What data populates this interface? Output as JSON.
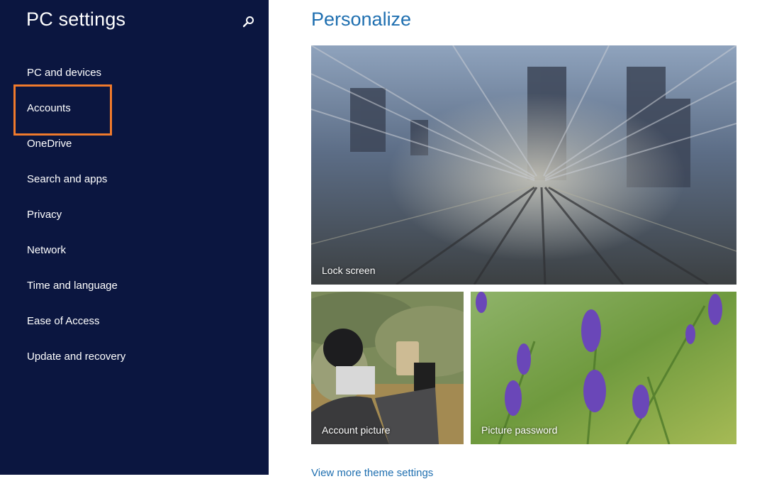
{
  "app": {
    "title": "PC settings",
    "search_icon": "search-icon"
  },
  "sidebar": {
    "items": [
      {
        "label": "PC and devices"
      },
      {
        "label": "Accounts",
        "highlighted": true
      },
      {
        "label": "OneDrive"
      },
      {
        "label": "Search and apps"
      },
      {
        "label": "Privacy"
      },
      {
        "label": "Network"
      },
      {
        "label": "Time and language"
      },
      {
        "label": "Ease of Access"
      },
      {
        "label": "Update and recovery"
      }
    ]
  },
  "main": {
    "title": "Personalize",
    "tiles": {
      "lock_screen": {
        "label": "Lock screen"
      },
      "account_picture": {
        "label": "Account picture"
      },
      "picture_password": {
        "label": "Picture password"
      }
    },
    "more_link": "View more theme settings"
  },
  "colors": {
    "sidebar_bg": "#0b1640",
    "accent": "#1f6fb0",
    "highlight_box": "#f07a2c"
  }
}
